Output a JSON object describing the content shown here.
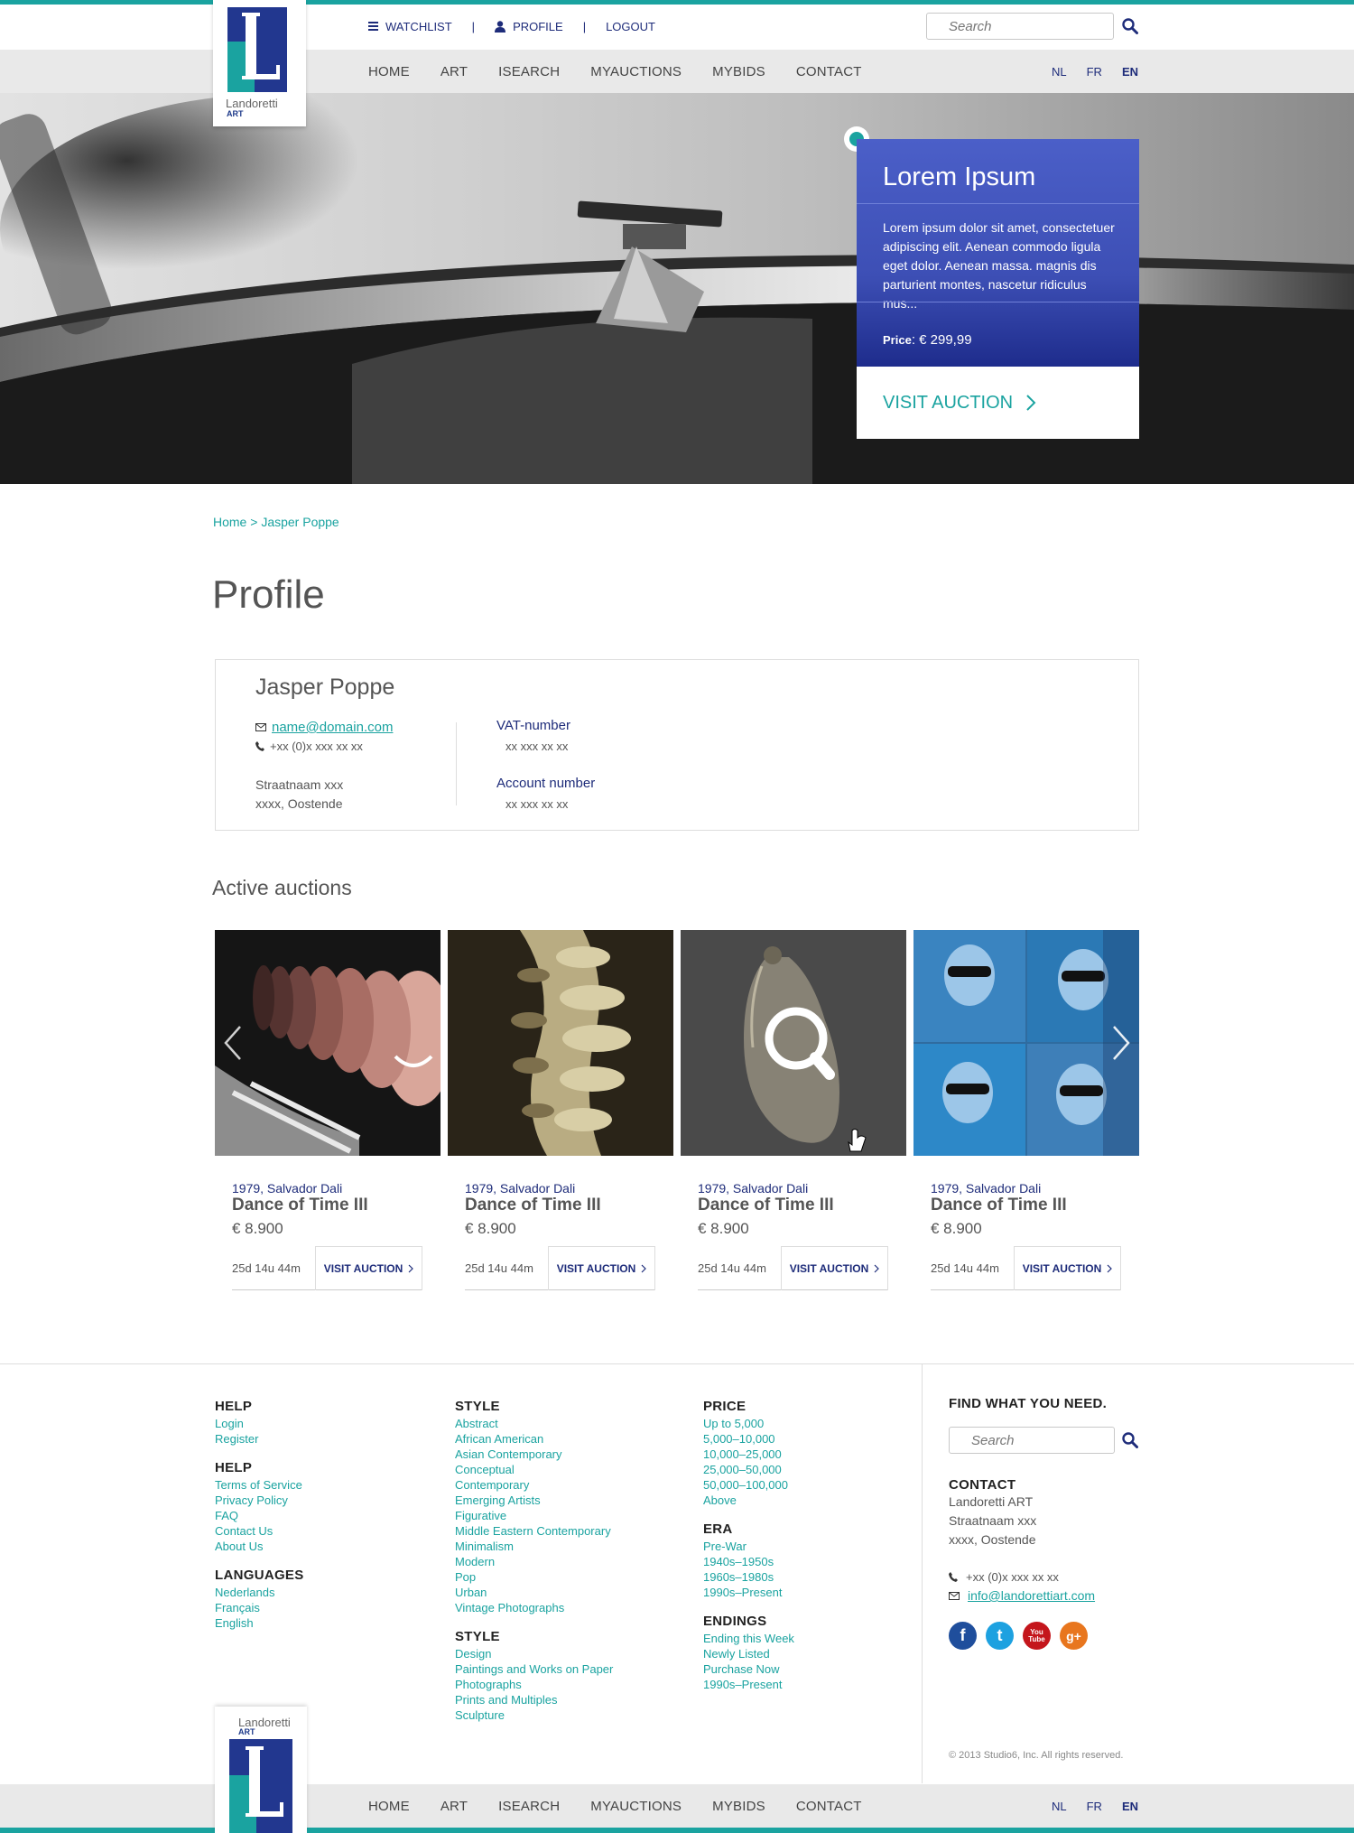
{
  "header": {
    "logo_word": "Landoretti",
    "logo_sub": "ART",
    "util": [
      {
        "icon": "list-icon",
        "label": "WATCHLIST"
      },
      {
        "icon": "person-icon",
        "label": "PROFILE"
      },
      {
        "label": "LOGOUT"
      }
    ],
    "util_sep": "|",
    "search_placeholder": "Search",
    "nav": [
      "HOME",
      "ART",
      "ISEARCH",
      "MYAUCTIONS",
      "MYBIDS",
      "CONTACT"
    ],
    "langs": [
      "NL",
      "FR",
      "EN"
    ],
    "active_lang": "EN"
  },
  "hero": {
    "title": "Lorem Ipsum",
    "text": "Lorem ipsum dolor sit amet, consectetuer adipiscing elit. Aenean commodo ligula eget dolor. Aenean massa. magnis dis parturient montes, nascetur ridiculus mus...",
    "price_label": "Price",
    "price_value": ": € 299,99",
    "cta": "VISIT AUCTION"
  },
  "breadcrumb": {
    "home": "Home",
    "sep": " > ",
    "current": "Jasper Poppe"
  },
  "page_title": "Profile",
  "profile": {
    "name": "Jasper Poppe",
    "email": "name@domain.com",
    "phone": "+xx (0)x xxx xx xx",
    "street": "Straatnaam xxx",
    "city": "xxxx, Oostende",
    "vat_label": "VAT-number",
    "vat_value": "xx xxx xx xx",
    "account_label": "Account number",
    "account_value": "xx xxx xx xx"
  },
  "auctions_title": "Active auctions",
  "auctions": [
    {
      "year_artist": "1979, Salvador Dali",
      "title": "Dance of Time III",
      "price": "€ 8.900",
      "time": "25d 14u 44m",
      "cta": "VISIT AUCTION"
    },
    {
      "year_artist": "1979, Salvador Dali",
      "title": "Dance of Time III",
      "price": "€ 8.900",
      "time": "25d 14u 44m",
      "cta": "VISIT AUCTION"
    },
    {
      "year_artist": "1979, Salvador Dali",
      "title": "Dance of Time III",
      "price": "€ 8.900",
      "time": "25d 14u 44m",
      "cta": "VISIT AUCTION"
    },
    {
      "year_artist": "1979, Salvador Dali",
      "title": "Dance of Time III",
      "price": "€ 8.900",
      "time": "25d 14u 44m",
      "cta": "VISIT AUCTION"
    }
  ],
  "footer": {
    "col1": [
      {
        "title": "HELP",
        "links": [
          "Login",
          "Register"
        ]
      },
      {
        "title": "HELP",
        "links": [
          "Terms of Service",
          "Privacy Policy",
          "FAQ",
          "Contact Us",
          "About Us"
        ]
      },
      {
        "title": "LANGUAGES",
        "links": [
          "Nederlands",
          "Français",
          "English"
        ]
      }
    ],
    "col2": [
      {
        "title": "STYLE",
        "links": [
          "Abstract",
          "African American",
          "Asian Contemporary",
          "Conceptual",
          "Contemporary",
          "Emerging Artists",
          "Figurative",
          "Middle Eastern Contemporary",
          "Minimalism",
          "Modern",
          "Pop",
          "Urban",
          "Vintage Photographs"
        ]
      },
      {
        "title": "STYLE",
        "links": [
          "Design",
          "Paintings and Works on Paper",
          "Photographs",
          "Prints and Multiples",
          "Sculpture"
        ]
      }
    ],
    "col3": [
      {
        "title": "PRICE",
        "links": [
          "Up to 5,000",
          "5,000–10,000",
          "10,000–25,000",
          "25,000–50,000",
          "50,000–100,000",
          "Above"
        ]
      },
      {
        "title": "ERA",
        "links": [
          "Pre-War",
          "1940s–1950s",
          "1960s–1980s",
          "1990s–Present"
        ]
      },
      {
        "title": "ENDINGS",
        "links": [
          "Ending this Week",
          "Newly Listed",
          "Purchase Now",
          "1990s–Present"
        ]
      }
    ],
    "find_title": "FIND WHAT YOU NEED.",
    "search_placeholder": "Search",
    "contact_title": "CONTACT",
    "contact_lines": [
      "Landoretti ART",
      "Straatnaam xxx",
      "xxxx, Oostende"
    ],
    "phone": "+xx (0)x xxx xx xx",
    "email": "info@landorettiart.com",
    "social": [
      {
        "icon": "facebook-icon",
        "label": "f",
        "color": "#1f4e9c"
      },
      {
        "icon": "twitter-icon",
        "label": "t",
        "color": "#1da1e0"
      },
      {
        "icon": "youtube-icon",
        "label": "You Tube",
        "color": "#c4161c"
      },
      {
        "icon": "googleplus-icon",
        "label": "g+",
        "color": "#e8761e"
      }
    ],
    "copyright": "© 2013 Studio6, Inc. All rights reserved."
  },
  "colors": {
    "teal": "#1aa3a0",
    "navy": "#1e2c7a",
    "panel_blue": "#4153bb",
    "logo_blue": "#22378f"
  }
}
